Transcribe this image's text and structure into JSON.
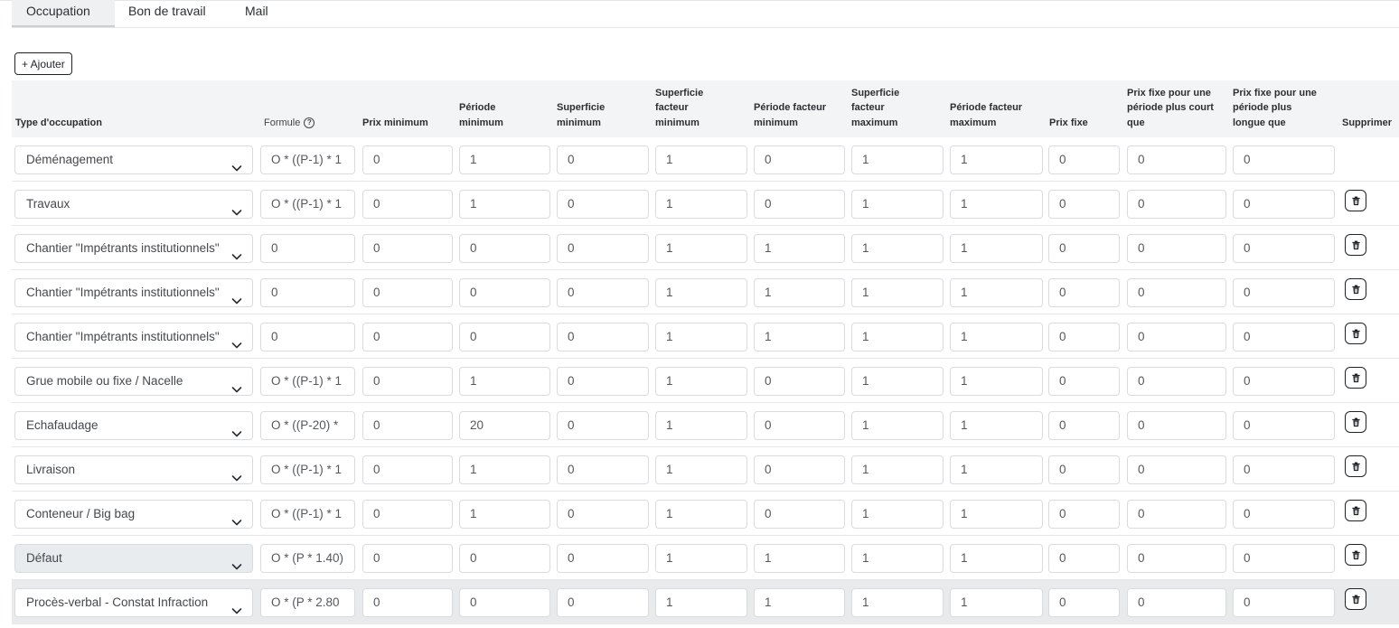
{
  "tabs": [
    {
      "label": "Occupation",
      "active": true
    },
    {
      "label": "Bon de travail",
      "active": false
    },
    {
      "label": "Mail",
      "active": false
    }
  ],
  "add_button": {
    "label": "+ Ajouter"
  },
  "columns": {
    "type": "Type d'occupation",
    "formule": "Formule",
    "prix_min": [
      "Prix minimum"
    ],
    "periode_min": [
      "Période",
      "minimum"
    ],
    "superficie_min": [
      "Superficie",
      "minimum"
    ],
    "superficie_facteur_min": [
      "Superficie",
      "facteur",
      "minimum"
    ],
    "periode_facteur_min": [
      "Période facteur",
      "minimum"
    ],
    "superficie_facteur_max": [
      "Superficie",
      "facteur",
      "maximum"
    ],
    "periode_facteur_max": [
      "Période facteur",
      "maximum"
    ],
    "prix_fixe": [
      "Prix fixe"
    ],
    "prix_fixe_court": [
      "Prix fixe pour une",
      "période plus court",
      "que"
    ],
    "prix_fixe_long": [
      "Prix fixe pour une",
      "période plus",
      "longue que"
    ],
    "supprimer": "Supprimer"
  },
  "rows": [
    {
      "type": "Déménagement",
      "formule": "O * ((P-1)  * 1",
      "prix_min": "0",
      "periode_min": "1",
      "superficie_min": "0",
      "sup_fac_min": "1",
      "per_fac_min": "0",
      "sup_fac_max": "1",
      "per_fac_max": "1",
      "prix_fixe": "0",
      "prix_fixe_court": "0",
      "prix_fixe_long": "0",
      "deletable": false,
      "disabled": false,
      "shaded": false
    },
    {
      "type": "Travaux",
      "formule": "O * ((P-1)  * 1",
      "prix_min": "0",
      "periode_min": "1",
      "superficie_min": "0",
      "sup_fac_min": "1",
      "per_fac_min": "0",
      "sup_fac_max": "1",
      "per_fac_max": "1",
      "prix_fixe": "0",
      "prix_fixe_court": "0",
      "prix_fixe_long": "0",
      "deletable": true,
      "disabled": false,
      "shaded": false
    },
    {
      "type": "Chantier \"Impétrants institutionnels\"",
      "formule": "0",
      "prix_min": "0",
      "periode_min": "0",
      "superficie_min": "0",
      "sup_fac_min": "1",
      "per_fac_min": "1",
      "sup_fac_max": "1",
      "per_fac_max": "1",
      "prix_fixe": "0",
      "prix_fixe_court": "0",
      "prix_fixe_long": "0",
      "deletable": true,
      "disabled": false,
      "shaded": false
    },
    {
      "type": "Chantier \"Impétrants institutionnels\"",
      "formule": "0",
      "prix_min": "0",
      "periode_min": "0",
      "superficie_min": "0",
      "sup_fac_min": "1",
      "per_fac_min": "1",
      "sup_fac_max": "1",
      "per_fac_max": "1",
      "prix_fixe": "0",
      "prix_fixe_court": "0",
      "prix_fixe_long": "0",
      "deletable": true,
      "disabled": false,
      "shaded": false
    },
    {
      "type": "Chantier \"Impétrants institutionnels\"",
      "formule": "0",
      "prix_min": "0",
      "periode_min": "0",
      "superficie_min": "0",
      "sup_fac_min": "1",
      "per_fac_min": "1",
      "sup_fac_max": "1",
      "per_fac_max": "1",
      "prix_fixe": "0",
      "prix_fixe_court": "0",
      "prix_fixe_long": "0",
      "deletable": true,
      "disabled": false,
      "shaded": false
    },
    {
      "type": "Grue mobile ou fixe / Nacelle",
      "formule": "O * ((P-1)  * 1",
      "prix_min": "0",
      "periode_min": "1",
      "superficie_min": "0",
      "sup_fac_min": "1",
      "per_fac_min": "0",
      "sup_fac_max": "1",
      "per_fac_max": "1",
      "prix_fixe": "0",
      "prix_fixe_court": "0",
      "prix_fixe_long": "0",
      "deletable": true,
      "disabled": false,
      "shaded": false
    },
    {
      "type": "Echafaudage",
      "formule": "O * ((P-20)  *",
      "prix_min": "0",
      "periode_min": "20",
      "superficie_min": "0",
      "sup_fac_min": "1",
      "per_fac_min": "0",
      "sup_fac_max": "1",
      "per_fac_max": "1",
      "prix_fixe": "0",
      "prix_fixe_court": "0",
      "prix_fixe_long": "0",
      "deletable": true,
      "disabled": false,
      "shaded": false
    },
    {
      "type": "Livraison",
      "formule": "O * ((P-1)  * 1",
      "prix_min": "0",
      "periode_min": "1",
      "superficie_min": "0",
      "sup_fac_min": "1",
      "per_fac_min": "0",
      "sup_fac_max": "1",
      "per_fac_max": "1",
      "prix_fixe": "0",
      "prix_fixe_court": "0",
      "prix_fixe_long": "0",
      "deletable": true,
      "disabled": false,
      "shaded": false
    },
    {
      "type": "Conteneur / Big bag",
      "formule": "O * ((P-1)  * 1",
      "prix_min": "0",
      "periode_min": "1",
      "superficie_min": "0",
      "sup_fac_min": "1",
      "per_fac_min": "0",
      "sup_fac_max": "1",
      "per_fac_max": "1",
      "prix_fixe": "0",
      "prix_fixe_court": "0",
      "prix_fixe_long": "0",
      "deletable": true,
      "disabled": false,
      "shaded": false
    },
    {
      "type": "Défaut",
      "formule": "O * (P  * 1.40)",
      "prix_min": "0",
      "periode_min": "0",
      "superficie_min": "0",
      "sup_fac_min": "1",
      "per_fac_min": "1",
      "sup_fac_max": "1",
      "per_fac_max": "1",
      "prix_fixe": "0",
      "prix_fixe_court": "0",
      "prix_fixe_long": "0",
      "deletable": true,
      "disabled": true,
      "shaded": false
    },
    {
      "type": "Procès-verbal - Constat Infraction",
      "formule": "O * (P  * 2.80",
      "prix_min": "0",
      "periode_min": "0",
      "superficie_min": "0",
      "sup_fac_min": "1",
      "per_fac_min": "1",
      "sup_fac_max": "1",
      "per_fac_max": "1",
      "prix_fixe": "0",
      "prix_fixe_court": "0",
      "prix_fixe_long": "0",
      "deletable": true,
      "disabled": false,
      "shaded": true
    }
  ]
}
